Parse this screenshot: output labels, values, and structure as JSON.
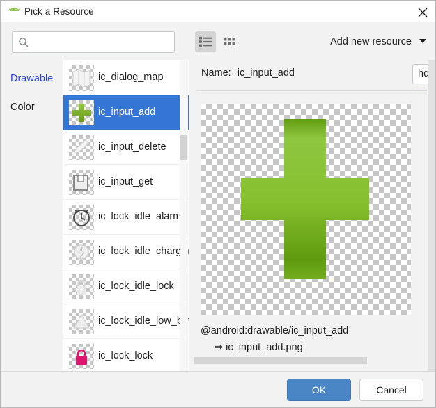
{
  "window": {
    "title": "Pick a Resource",
    "app_icon": "android-icon",
    "close_icon": "close-icon"
  },
  "toolbar": {
    "search": {
      "value": "",
      "placeholder": "",
      "icon": "search-icon"
    },
    "view_list_label": "list-view-icon",
    "view_grid_label": "grid-view-icon",
    "add_resource_label": "Add new resource",
    "add_resource_caret": "chevron-down-icon"
  },
  "categories": [
    {
      "label": "Drawable",
      "selected": true
    },
    {
      "label": "Color",
      "selected": false
    }
  ],
  "resources": [
    {
      "label": "ic_dialog_map",
      "selected": false,
      "icon": "map-thumbnail"
    },
    {
      "label": "ic_input_add",
      "selected": true,
      "icon": "green-plus-thumbnail"
    },
    {
      "label": "ic_input_delete",
      "selected": false,
      "icon": "delete-thumbnail"
    },
    {
      "label": "ic_input_get",
      "selected": false,
      "icon": "get-thumbnail"
    },
    {
      "label": "ic_lock_idle_alarm",
      "selected": false,
      "icon": "alarm-thumbnail"
    },
    {
      "label": "ic_lock_idle_charging",
      "selected": false,
      "icon": "charging-thumbnail"
    },
    {
      "label": "ic_lock_idle_lock",
      "selected": false,
      "icon": "lock-thumbnail"
    },
    {
      "label": "ic_lock_idle_low_battery",
      "selected": false,
      "icon": "battery-thumbnail"
    },
    {
      "label": "ic_lock_lock",
      "selected": false,
      "icon": "pink-lock-thumbnail"
    }
  ],
  "preview": {
    "name_label": "Name:",
    "name_value": "ic_input_add",
    "density": "hdpi",
    "resource_path": "@android:drawable/ic_input_add",
    "file_name": "⇒ ic_input_add.png",
    "image_icon": "green-plus-icon"
  },
  "footer": {
    "ok_label": "OK",
    "cancel_label": "Cancel"
  },
  "colors": {
    "selection_blue": "#3575d3",
    "category_selected": "#2b44d8",
    "ok_button": "#4a86c5",
    "plus_green_light": "#8ec63f",
    "plus_green_dark": "#5a8a15",
    "pink_lock": "#e0146e",
    "window_bg": "#f2f2f2"
  }
}
